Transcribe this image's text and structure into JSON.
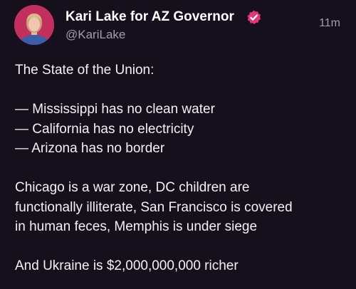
{
  "tweet": {
    "author": {
      "display_name": "Kari Lake for AZ Governor",
      "handle": "@KariLake",
      "verified": true,
      "avatar": "portrait-avatar"
    },
    "timestamp": "11m",
    "lines": {
      "intro": "The State of the Union:",
      "bullet_1": "— Mississippi has no clean water",
      "bullet_2": "— California has no electricity",
      "bullet_3": "— Arizona has no border",
      "para_1": "Chicago is a war zone, DC children are",
      "para_2": "functionally illiterate, San Francisco is covered",
      "para_3": "in human feces, Memphis is under siege",
      "closing": "And Ukraine is $2,000,000,000 richer"
    }
  },
  "colors": {
    "background": "#15101c",
    "text": "#f4f1f6",
    "secondary_text": "#a39cad",
    "verified_badge": "#e2367a",
    "avatar_background": "#c4305e"
  }
}
